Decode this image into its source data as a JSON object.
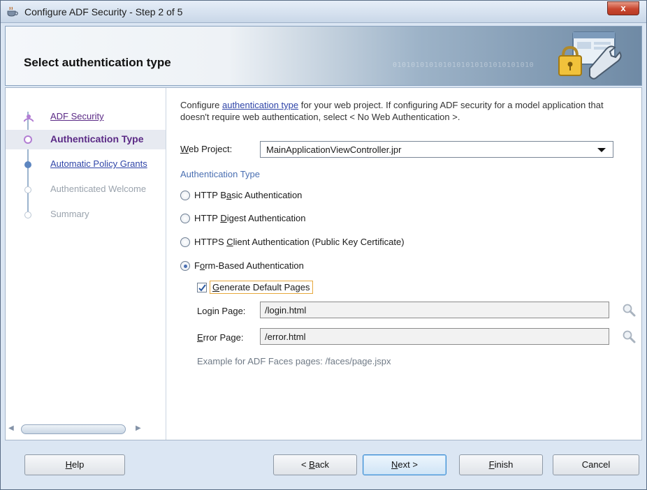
{
  "window": {
    "title": "Configure ADF Security - Step 2 of 5",
    "close_label": "x"
  },
  "banner": {
    "heading": "Select authentication type",
    "binary_text": "0101010101010101010101010101010"
  },
  "nav": {
    "items": [
      {
        "label": "ADF Security",
        "state": "visited"
      },
      {
        "label": "Authentication Type",
        "state": "active"
      },
      {
        "label": "Automatic Policy Grants",
        "state": "link"
      },
      {
        "label": "Authenticated Welcome",
        "state": "disabled"
      },
      {
        "label": "Summary",
        "state": "disabled"
      }
    ]
  },
  "intro": {
    "prefix": "Configure ",
    "link": "authentication type",
    "suffix": " for your web project. If configuring ADF security for a model application that doesn't require web authentication, select < No Web Authentication >."
  },
  "web_project": {
    "label_mnemonic": "W",
    "label_rest": "eb Project:",
    "value": "MainApplicationViewController.jpr"
  },
  "auth_type": {
    "section_title": "Authentication Type",
    "options": [
      {
        "pre": "HTTP B",
        "mn": "a",
        "post": "sic Authentication",
        "checked": false
      },
      {
        "pre": "HTTP ",
        "mn": "D",
        "post": "igest Authentication",
        "checked": false
      },
      {
        "pre": "HTTPS ",
        "mn": "C",
        "post": "lient Authentication (Public Key Certificate)",
        "checked": false
      },
      {
        "pre": "F",
        "mn": "o",
        "post": "rm-Based Authentication",
        "checked": true
      }
    ]
  },
  "form_based": {
    "generate_default": {
      "mn": "G",
      "rest": "enerate Default Pages",
      "checked": true
    },
    "login_page": {
      "label_pre": "Login Pa",
      "label_mn": "g",
      "label_post": "e:",
      "value": "/login.html"
    },
    "error_page": {
      "label_mn": "E",
      "label_post": "rror Page:",
      "value": "/error.html"
    },
    "example": "Example for ADF Faces pages: /faces/page.jspx"
  },
  "buttons": {
    "help": {
      "mn": "H",
      "rest": "elp"
    },
    "back": {
      "pre": "< ",
      "mn": "B",
      "rest": "ack"
    },
    "next": {
      "mn": "N",
      "rest": "ext >"
    },
    "finish": {
      "mn": "F",
      "rest": "inish"
    },
    "cancel": {
      "label": "Cancel"
    }
  },
  "colors": {
    "accent": "#4a6fb2",
    "link": "#2f45a8",
    "visited": "#5b2a86",
    "highlight_border": "#e6a83d",
    "close_button": "#c8462f"
  },
  "icons": [
    "app-cup-icon",
    "close-icon",
    "lock-wrench-icon",
    "dropdown-caret-icon",
    "magnifier-icon",
    "checkmark-icon"
  ]
}
